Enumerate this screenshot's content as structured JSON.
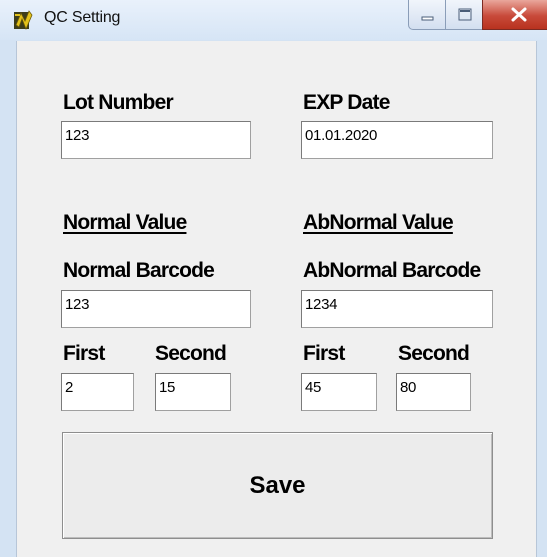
{
  "window": {
    "title": "QC Setting"
  },
  "lot": {
    "label": "Lot Number",
    "value": "123"
  },
  "exp": {
    "label": "EXP Date",
    "value": "01.01.2020"
  },
  "normal": {
    "section_label": "Normal Value",
    "barcode_label": "Normal Barcode",
    "barcode_value": "123",
    "first_label": "First",
    "first_value": "2",
    "second_label": "Second",
    "second_value": "15"
  },
  "abnormal": {
    "section_label": "AbNormal Value",
    "barcode_label": "AbNormal Barcode",
    "barcode_value": "1234",
    "first_label": "First",
    "first_value": "45",
    "second_label": "Second",
    "second_value": "80"
  },
  "save_label": "Save",
  "icons": {
    "app": "qc-app-icon",
    "minimize": "minimize-icon",
    "maximize": "maximize-icon",
    "close": "close-icon"
  },
  "colors": {
    "titlebar": "#d6e5f6",
    "client": "#f0f0f0",
    "close": "#c84a3a"
  }
}
